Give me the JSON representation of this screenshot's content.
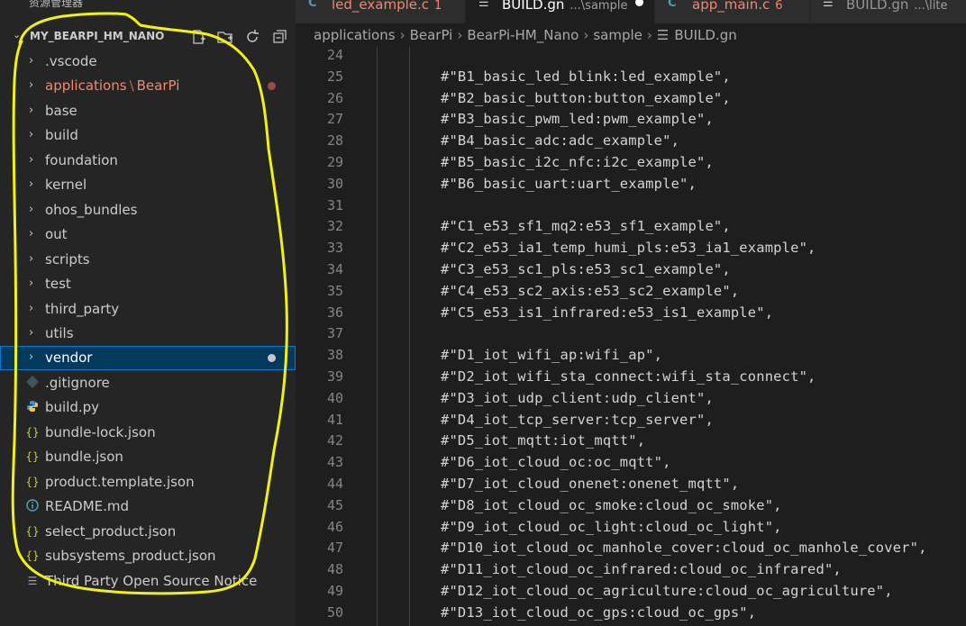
{
  "explorer": {
    "title": "资源管理器",
    "more": "···",
    "root_label": "MY_BEARPI_HM_NANO",
    "items": [
      {
        "label": "vscode"
      },
      {
        "label": "applications",
        "sub": "BearPi"
      },
      {
        "label": "base"
      },
      {
        "label": "build"
      },
      {
        "label": "foundation"
      },
      {
        "label": "kernel"
      },
      {
        "label": "ohos_bundles"
      },
      {
        "label": "out"
      },
      {
        "label": "scripts"
      },
      {
        "label": "test"
      },
      {
        "label": "third_party"
      },
      {
        "label": "utils"
      },
      {
        "label": "vendor"
      },
      {
        "label": ".gitignore"
      },
      {
        "label": "build.py"
      },
      {
        "label": "bundle-lock.json"
      },
      {
        "label": "bundle.json"
      },
      {
        "label": "product.template.json"
      },
      {
        "label": "README.md"
      },
      {
        "label": "select_product.json"
      },
      {
        "label": "subsystems_product.json"
      },
      {
        "label": "Third Party Open Source Notice"
      }
    ]
  },
  "tabs": [
    {
      "name": "led_example.c",
      "badge": "1"
    },
    {
      "name": "BUILD.gn",
      "desc": "...\\sample"
    },
    {
      "name": "app_main.c",
      "badge": "6"
    },
    {
      "name": "BUILD.gn",
      "desc": "...\\lite"
    }
  ],
  "breadcrumb": [
    "applications",
    "BearPi",
    "BearPi-HM_Nano",
    "sample",
    "BUILD.gn"
  ],
  "editor": {
    "lines": [
      {
        "n": "24",
        "t": ""
      },
      {
        "n": "25",
        "t": "#\"B1_basic_led_blink:led_example\","
      },
      {
        "n": "26",
        "t": "#\"B2_basic_button:button_example\","
      },
      {
        "n": "27",
        "t": "#\"B3_basic_pwm_led:pwm_example\","
      },
      {
        "n": "28",
        "t": "#\"B4_basic_adc:adc_example\","
      },
      {
        "n": "29",
        "t": "#\"B5_basic_i2c_nfc:i2c_example\","
      },
      {
        "n": "30",
        "t": "#\"B6_basic_uart:uart_example\","
      },
      {
        "n": "31",
        "t": ""
      },
      {
        "n": "32",
        "t": "#\"C1_e53_sf1_mq2:e53_sf1_example\","
      },
      {
        "n": "33",
        "t": "#\"C2_e53_ia1_temp_humi_pls:e53_ia1_example\","
      },
      {
        "n": "34",
        "t": "#\"C3_e53_sc1_pls:e53_sc1_example\","
      },
      {
        "n": "35",
        "t": "#\"C4_e53_sc2_axis:e53_sc2_example\","
      },
      {
        "n": "36",
        "t": "#\"C5_e53_is1_infrared:e53_is1_example\","
      },
      {
        "n": "37",
        "t": ""
      },
      {
        "n": "38",
        "t": "#\"D1_iot_wifi_ap:wifi_ap\","
      },
      {
        "n": "39",
        "t": "#\"D2_iot_wifi_sta_connect:wifi_sta_connect\","
      },
      {
        "n": "40",
        "t": "#\"D3_iot_udp_client:udp_client\","
      },
      {
        "n": "41",
        "t": "#\"D4_iot_tcp_server:tcp_server\","
      },
      {
        "n": "42",
        "t": "#\"D5_iot_mqtt:iot_mqtt\","
      },
      {
        "n": "43",
        "t": "#\"D6_iot_cloud_oc:oc_mqtt\","
      },
      {
        "n": "44",
        "t": "#\"D7_iot_cloud_onenet:onenet_mqtt\","
      },
      {
        "n": "45",
        "t": "#\"D8_iot_cloud_oc_smoke:cloud_oc_smoke\","
      },
      {
        "n": "46",
        "t": "#\"D9_iot_cloud_oc_light:cloud_oc_light\","
      },
      {
        "n": "47",
        "t": "#\"D10_iot_cloud_oc_manhole_cover:cloud_oc_manhole_cover\","
      },
      {
        "n": "48",
        "t": "#\"D11_iot_cloud_oc_infrared:cloud_oc_infrared\","
      },
      {
        "n": "49",
        "t": "#\"D12_iot_cloud_oc_agriculture:cloud_oc_agriculture\","
      },
      {
        "n": "50",
        "t": "#\"D13_iot_cloud_oc_gps:cloud_oc_gps\","
      }
    ]
  }
}
